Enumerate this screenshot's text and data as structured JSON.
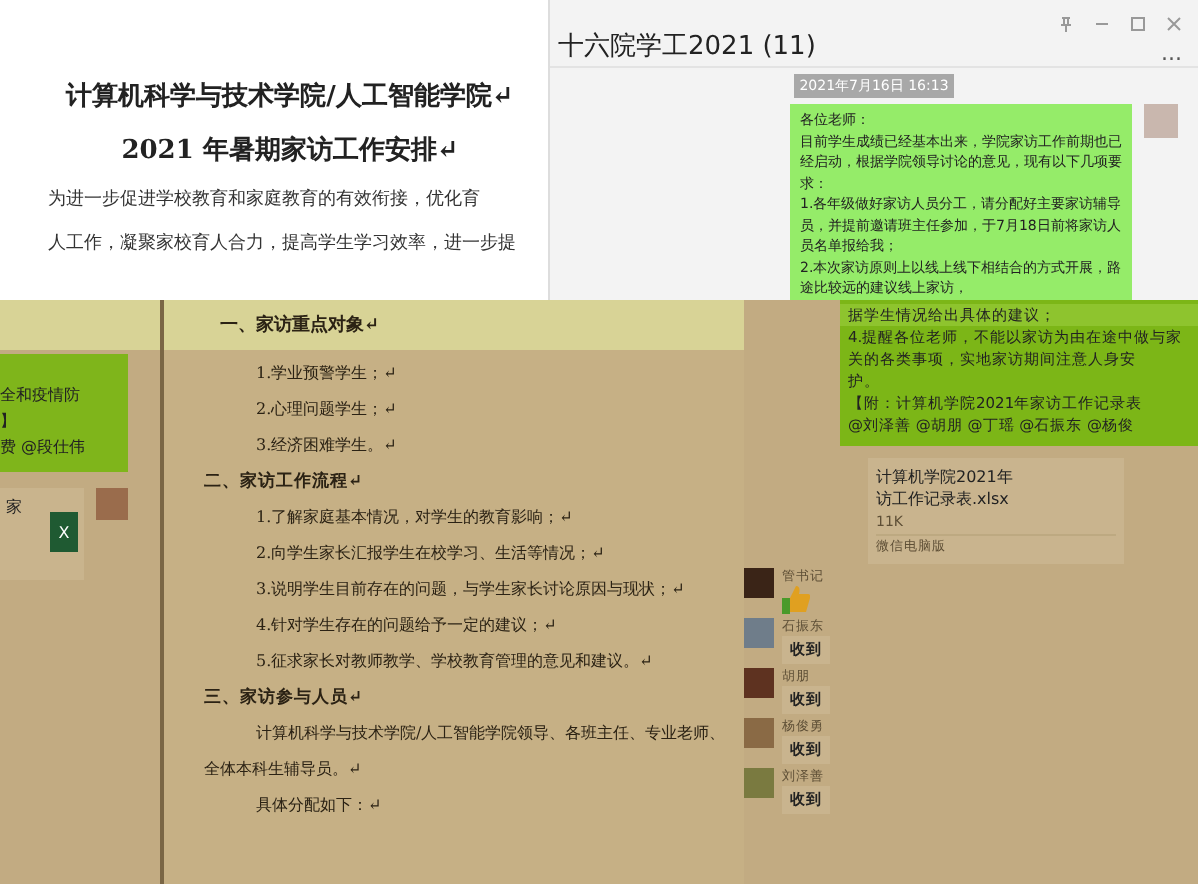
{
  "top_document": {
    "title_lines": [
      "计算机科学与技术学院/人工智能学院↵",
      "2021 年暑期家访工作安排↵"
    ],
    "paragraph_lines": [
      "为进一步促进学校教育和家庭教育的有效衔接，优化育",
      "人工作，凝聚家校育人合力，提高学生学习效率，进一步提"
    ]
  },
  "top_chat": {
    "title": "十六院学工2021 (11)",
    "more": "...",
    "timestamp": "2021年7月16日 16:13",
    "message_lines": [
      "各位老师：",
      "目前学生成绩已经基本出来，学院家访工作前期也已",
      "经启动，根据学院领导讨论的意见，现有以下几项要",
      "求：",
      "1.各年级做好家访人员分工，请分配好主要家访辅导",
      "员，并提前邀请班主任参加，于7月18日前将家访人",
      "员名单报给我；",
      "2.本次家访原则上以线上线下相结合的方式开展，路",
      "途比较远的建议线上家访，"
    ]
  },
  "left_fragment": {
    "message_lines": [
      "全和疫情防",
      "】",
      "费 @段仕伟"
    ],
    "file_name": "家",
    "file_type": "X"
  },
  "document": {
    "blocks": [
      {
        "kind": "heading",
        "text": "一、家访重点对象↵"
      },
      {
        "kind": "item",
        "text": "1.学业预警学生；↵"
      },
      {
        "kind": "item",
        "text": "2.心理问题学生；↵"
      },
      {
        "kind": "item",
        "text": "3.经济困难学生。↵"
      },
      {
        "kind": "heading",
        "text": "二、家访工作流程↵"
      },
      {
        "kind": "item",
        "text": "1.了解家庭基本情况，对学生的教育影响；↵"
      },
      {
        "kind": "item",
        "text": "2.向学生家长汇报学生在校学习、生活等情况；↵"
      },
      {
        "kind": "item",
        "text": "3.说明学生目前存在的问题，与学生家长讨论原因与现状；↵"
      },
      {
        "kind": "item",
        "text": "4.针对学生存在的问题给予一定的建议；↵"
      },
      {
        "kind": "item",
        "text": "5.征求家长对教师教学、学校教育管理的意见和建议。↵"
      },
      {
        "kind": "heading",
        "text": "三、家访参与人员↵"
      },
      {
        "kind": "item",
        "text": "计算机科学与技术学院/人工智能学院领导、各班主任、专业老师、全体本科生辅导员。↵"
      },
      {
        "kind": "item",
        "text": "具体分配如下：↵"
      }
    ]
  },
  "chat": {
    "message_lines": [
      "据学生情况给出具体的建议；",
      "4.提醒各位老师，不能以家访为由在途中做与家",
      "关的各类事项，实地家访期间注意人身安",
      "护。",
      "【附：计算机学院2021年家访工作记录表",
      "@刘泽善 @胡朋 @丁瑶 @石振东 @杨俊"
    ],
    "file": {
      "name_lines": [
        "计算机学院2021年",
        "访工作记录表.xlsx"
      ],
      "size": "11K",
      "source": "微信电脑版"
    },
    "replies": [
      {
        "sender": "管书记",
        "kind": "thumbs"
      },
      {
        "sender": "石振东",
        "kind": "text",
        "text": "收到"
      },
      {
        "sender": "胡朋",
        "kind": "text",
        "text": "收到"
      },
      {
        "sender": "杨俊勇",
        "kind": "text",
        "text": "收到"
      },
      {
        "sender": "刘泽善",
        "kind": "text",
        "text": "收到"
      }
    ]
  }
}
